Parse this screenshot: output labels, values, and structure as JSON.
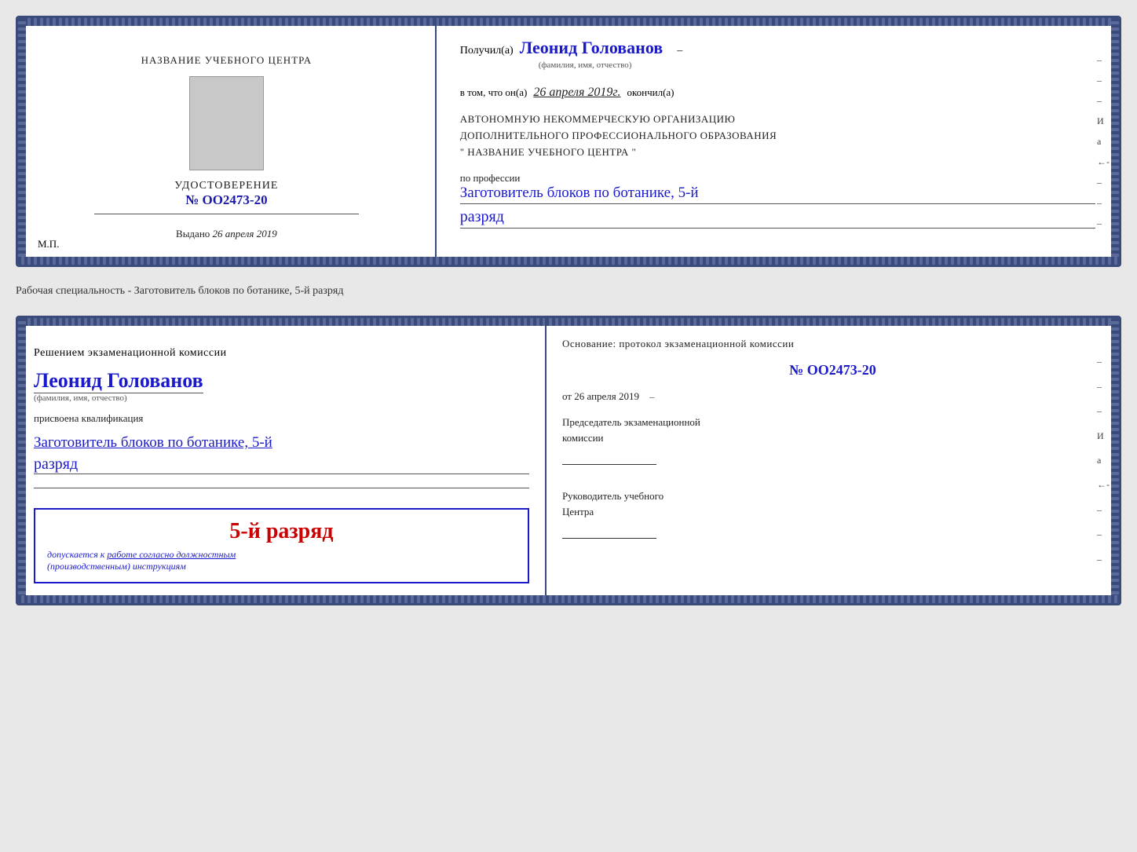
{
  "page": {
    "background_color": "#e8e8e8"
  },
  "doc1": {
    "left": {
      "training_center_title": "НАЗВАНИЕ УЧЕБНОГО ЦЕНТРА",
      "certificate_label": "УДОСТОВЕРЕНИЕ",
      "certificate_number": "№ OO2473-20",
      "issued_label": "Выдано",
      "issued_date": "26 апреля 2019",
      "mp_label": "М.П."
    },
    "right": {
      "received_label": "Получил(а)",
      "recipient_name": "Леонид Голованов",
      "name_hint": "(фамилия, имя, отчество)",
      "confirm_text": "в том, что он(а)",
      "confirm_date": "26 апреля 2019г.",
      "finished_label": "окончил(а)",
      "org_line1": "АВТОНОМНУЮ НЕКОММЕРЧЕСКУЮ ОРГАНИЗАЦИЮ",
      "org_line2": "ДОПОЛНИТЕЛЬНОГО ПРОФЕССИОНАЛЬНОГО ОБРАЗОВАНИЯ",
      "org_line3": "\"   НАЗВАНИЕ УЧЕБНОГО ЦЕНТРА   \"",
      "profession_label": "по профессии",
      "profession_value": "Заготовитель блоков по ботанике, 5-й",
      "razryad_value": "разряд"
    }
  },
  "separator": {
    "text": "Рабочая специальность - Заготовитель блоков по ботанике, 5-й разряд"
  },
  "doc2": {
    "left": {
      "decision_text": "Решением экзаменационной комиссии",
      "person_name": "Леонид Голованов",
      "name_hint": "(фамилия, имя, отчество)",
      "qualification_label": "присвоена квалификация",
      "qualification_value": "Заготовитель блоков по ботанике, 5-й",
      "razryad_value": "разряд",
      "stamp_grade": "5-й разряд",
      "stamp_text": "допускается к работе согласно должностным\n(производственным) инструкциям"
    },
    "right": {
      "basis_text": "Основание: протокол экзаменационной комиссии",
      "protocol_number": "№ OO2473-20",
      "date_prefix": "от",
      "date_value": "26 апреля 2019",
      "chairman_label": "Председатель экзаменационной\nкомиссии",
      "director_label": "Руководитель учебного\nЦентра"
    }
  }
}
